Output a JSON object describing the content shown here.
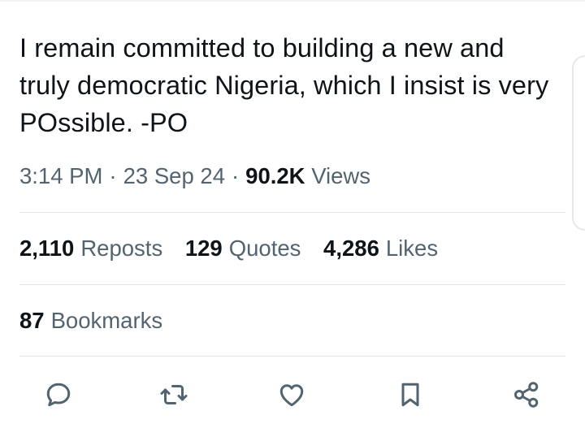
{
  "tweet": {
    "text": "I remain committed to building a new and truly democratic Nigeria, which I insist is very POssible. -PO",
    "time": "3:14 PM",
    "date": "23 Sep 24",
    "views_count": "90.2K",
    "views_label": "Views"
  },
  "stats": {
    "reposts": {
      "count": "2,110",
      "label": "Reposts"
    },
    "quotes": {
      "count": "129",
      "label": "Quotes"
    },
    "likes": {
      "count": "4,286",
      "label": "Likes"
    },
    "bookmarks": {
      "count": "87",
      "label": "Bookmarks"
    }
  },
  "actions": {
    "icons": [
      "reply-icon",
      "repost-icon",
      "like-icon",
      "bookmark-icon",
      "share-icon"
    ],
    "icon_color": "#536471"
  },
  "colors": {
    "text": "#0f1419",
    "secondary": "#536471",
    "divider": "#dfe3e6"
  }
}
